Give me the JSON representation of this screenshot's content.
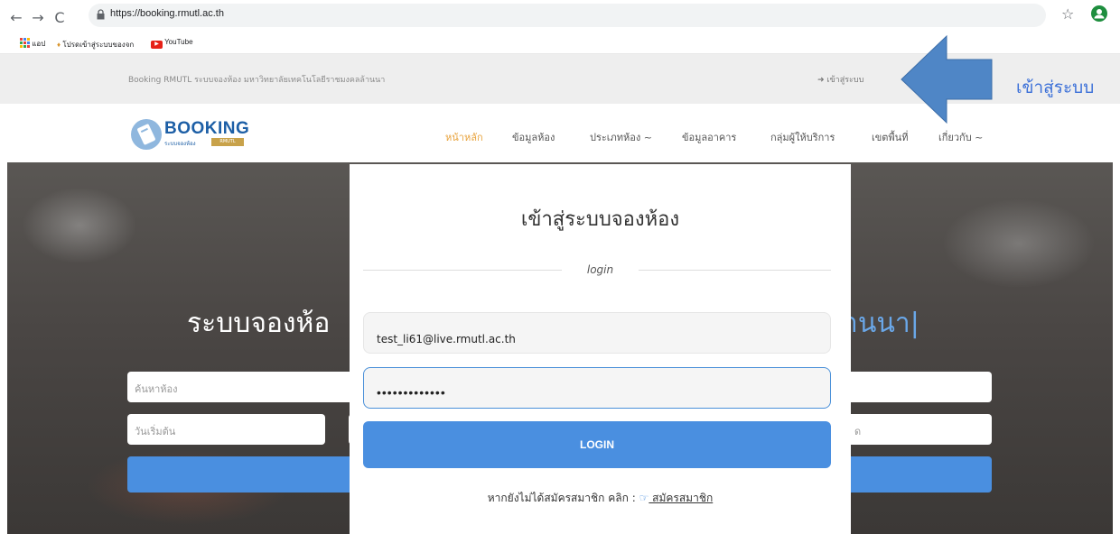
{
  "browser": {
    "url": "https://booking.rmutl.ac.th",
    "bookmarks": [
      {
        "label": "แอป",
        "icon": "apps-grid-icon"
      },
      {
        "label": "โปรดเข้าสู่ระบบของจก",
        "icon": "bookmark-favicon-icon"
      },
      {
        "label": "YouTube",
        "icon": "youtube-icon"
      }
    ]
  },
  "topbar": {
    "tagline": "Booking RMUTL ระบบจองห้อง มหาวิทยาลัยเทคโนโลยีราชมงคลล้านนา",
    "login_link": "เข้าสู่ระบบ"
  },
  "annotation": {
    "text": "เข้าสู่ระบบ",
    "arrow_color": "#4f86c6"
  },
  "logo": {
    "title": "BOOKING",
    "subtitle": "ระบบจองห้อง",
    "tag": "RMUTL"
  },
  "nav": {
    "items": [
      {
        "label": "หน้าหลัก",
        "active": true
      },
      {
        "label": "ข้อมูลห้อง"
      },
      {
        "label": "ประเภทห้อง ~"
      },
      {
        "label": "ข้อมูลอาคาร"
      },
      {
        "label": "กลุ่มผู้ให้บริการ"
      },
      {
        "label": "เขตพื้นที่"
      },
      {
        "label": "เกี่ยวกับ ~"
      }
    ],
    "active_color": "#e8a33d"
  },
  "hero": {
    "title_left": "ระบบจองห้อ",
    "title_right": "านนา",
    "search_placeholder": "ค้นหาห้อง",
    "start_date_placeholder": "วันเริ่มต้น",
    "end_placeholder": "ด"
  },
  "modal": {
    "title": "เข้าสู่ระบบจองห้อง",
    "subtitle": "login",
    "email_value": "test_li61@live.rmutl.ac.th",
    "password_value": "•••••••••••••",
    "login_button": "LOGIN",
    "register_prompt": "หากยังไม่ได้สมัครสมาชิก คลิก : ",
    "register_link": " สมัครสมาชิก"
  },
  "colors": {
    "primary": "#4a8fe0",
    "brand": "#1d5fa6"
  }
}
